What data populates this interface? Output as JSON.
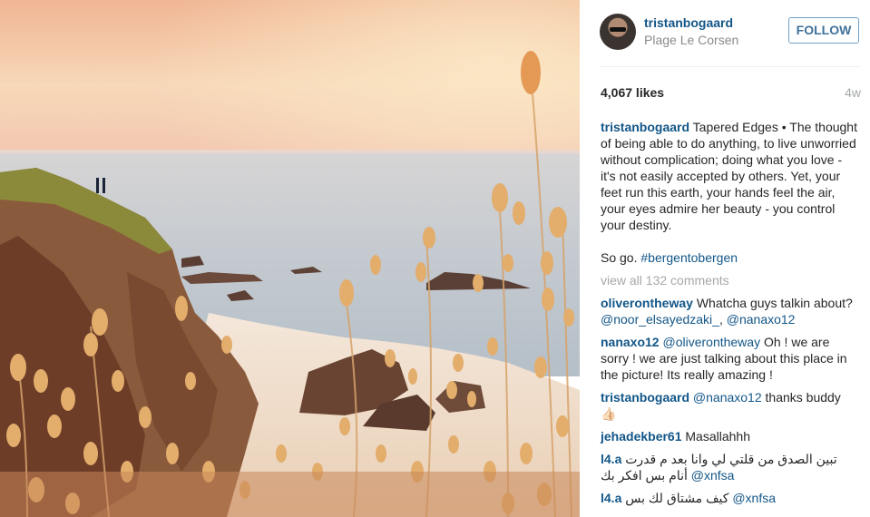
{
  "post": {
    "username": "tristanbogaard",
    "location": "Plage Le Corsen",
    "follow_label": "FOLLOW",
    "likes": "4,067 likes",
    "time_ago": "4w"
  },
  "caption": {
    "username": "tristanbogaard",
    "text": "Tapered Edges • The thought of being able to do anything, to live unworried without complication; doing what you love - it's not easily accepted by others. Yet, your feet run this earth, your hands feel the air, your eyes admire her beauty - you control your destiny.",
    "closing": "So go.",
    "hashtag": "#bergentobergen"
  },
  "view_all_comments": "view all 132 comments",
  "comments": [
    {
      "username": "oliverontheway",
      "text": "Whatcha guys talkin about?",
      "mentions": [
        "@noor_elsayedzaki_",
        "@nanaxo12"
      ]
    },
    {
      "username": "nanaxo12",
      "mention": "@oliverontheway",
      "text": "Oh ! we are sorry ! we are just talking about this place in the picture! Its really amazing !"
    },
    {
      "username": "tristanbogaard",
      "mention": "@nanaxo12",
      "text": "thanks buddy 👍🏻"
    },
    {
      "username": "jehadekber61",
      "text": "Masallahhh"
    },
    {
      "username": "l4.a",
      "text": "تبين الصدق من قلتي لي وانا بعد م قدرت أنام بس افكر بك",
      "mention": "@xnfsa"
    },
    {
      "username": "l4.a",
      "text": "كيف مشتاق لك بس",
      "mention": "@xnfsa"
    }
  ],
  "colors": {
    "username_blue": "#125688",
    "follow_border": "#70a0c8",
    "muted_gray": "#a5a7aa"
  },
  "icons": {
    "avatar": "profile-photo"
  }
}
